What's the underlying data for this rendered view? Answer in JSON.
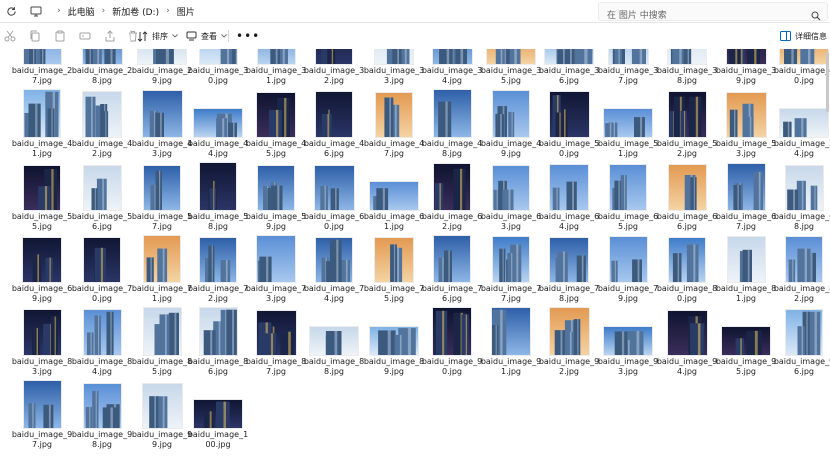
{
  "addressbar": {
    "breadcrumbs": [
      "此电脑",
      "新加卷 (D:)",
      "图片"
    ],
    "search_placeholder": "在 图片 中搜索"
  },
  "toolbar": {
    "sort_label": "排序",
    "view_label": "查看",
    "details_label": "详细信息",
    "icons": [
      "cut-icon",
      "copy-icon",
      "paste-icon",
      "rename-icon",
      "share-icon",
      "delete-icon"
    ]
  },
  "files": {
    "partial_top_row": [
      [
        "baidu_image_2",
        "7.jpg"
      ],
      [
        "baidu_image_2",
        "8.jpg"
      ],
      [
        "baidu_image_2",
        "9.jpg"
      ],
      [
        "baidu_image_3",
        "0.jpg"
      ],
      [
        "baidu_image_3",
        "1.jpg"
      ],
      [
        "baidu_image_3",
        "2.jpg"
      ],
      [
        "baidu_image_3",
        "3.jpg"
      ],
      [
        "baidu_image_3",
        "4.jpg"
      ],
      [
        "baidu_image_3",
        "5.jpg"
      ],
      [
        "baidu_image_3",
        "6.jpg"
      ],
      [
        "baidu_image_3",
        "7.jpg"
      ],
      [
        "baidu_image_3",
        "8.jpg"
      ],
      [
        "baidu_image_3",
        "9.jpg"
      ],
      [
        "baidu_image_4",
        "0.jpg"
      ]
    ],
    "rows": [
      [
        [
          "baidu_image_4",
          "1.jpg"
        ],
        [
          "baidu_image_4",
          "2.jpg"
        ],
        [
          "baidu_image_4",
          "3.jpg"
        ],
        [
          "baidu_image_4",
          "4.jpg"
        ],
        [
          "baidu_image_4",
          "5.jpg"
        ],
        [
          "baidu_image_4",
          "6.jpg"
        ],
        [
          "baidu_image_4",
          "7.jpg"
        ],
        [
          "baidu_image_4",
          "8.jpg"
        ],
        [
          "baidu_image_4",
          "9.jpg"
        ],
        [
          "baidu_image_5",
          "0.jpg"
        ],
        [
          "baidu_image_5",
          "1.jpg"
        ],
        [
          "baidu_image_5",
          "2.jpg"
        ],
        [
          "baidu_image_5",
          "3.jpg"
        ],
        [
          "baidu_image_5",
          "4.jpg"
        ]
      ],
      [
        [
          "baidu_image_5",
          "5.jpg"
        ],
        [
          "baidu_image_5",
          "6.jpg"
        ],
        [
          "baidu_image_5",
          "7.jpg"
        ],
        [
          "baidu_image_5",
          "8.jpg"
        ],
        [
          "baidu_image_5",
          "9.jpg"
        ],
        [
          "baidu_image_6",
          "0.jpg"
        ],
        [
          "baidu_image_6",
          "1.jpg"
        ],
        [
          "baidu_image_6",
          "2.jpg"
        ],
        [
          "baidu_image_6",
          "3.jpg"
        ],
        [
          "baidu_image_6",
          "4.jpg"
        ],
        [
          "baidu_image_6",
          "5.jpg"
        ],
        [
          "baidu_image_6",
          "6.jpg"
        ],
        [
          "baidu_image_6",
          "7.jpg"
        ],
        [
          "baidu_image_6",
          "8.jpg"
        ]
      ],
      [
        [
          "baidu_image_6",
          "9.jpg"
        ],
        [
          "baidu_image_7",
          "0.jpg"
        ],
        [
          "baidu_image_7",
          "1.jpg"
        ],
        [
          "baidu_image_7",
          "2.jpg"
        ],
        [
          "baidu_image_7",
          "3.jpg"
        ],
        [
          "baidu_image_7",
          "4.jpg"
        ],
        [
          "baidu_image_7",
          "5.jpg"
        ],
        [
          "baidu_image_7",
          "6.jpg"
        ],
        [
          "baidu_image_7",
          "7.jpg"
        ],
        [
          "baidu_image_7",
          "8.jpg"
        ],
        [
          "baidu_image_7",
          "9.jpg"
        ],
        [
          "baidu_image_8",
          "0.jpg"
        ],
        [
          "baidu_image_8",
          "1.jpg"
        ],
        [
          "baidu_image_8",
          "2.jpg"
        ]
      ],
      [
        [
          "baidu_image_8",
          "3.jpg"
        ],
        [
          "baidu_image_8",
          "4.jpg"
        ],
        [
          "baidu_image_8",
          "5.jpg"
        ],
        [
          "baidu_image_8",
          "6.jpg"
        ],
        [
          "baidu_image_8",
          "7.jpg"
        ],
        [
          "baidu_image_8",
          "8.jpg"
        ],
        [
          "baidu_image_8",
          "9.jpg"
        ],
        [
          "baidu_image_9",
          "0.jpg"
        ],
        [
          "baidu_image_9",
          "1.jpg"
        ],
        [
          "baidu_image_9",
          "2.jpg"
        ],
        [
          "baidu_image_9",
          "3.jpg"
        ],
        [
          "baidu_image_9",
          "4.jpg"
        ],
        [
          "baidu_image_9",
          "5.jpg"
        ],
        [
          "baidu_image_9",
          "6.jpg"
        ]
      ],
      [
        [
          "baidu_image_9",
          "7.jpg"
        ],
        [
          "baidu_image_9",
          "8.jpg"
        ],
        [
          "baidu_image_9",
          "9.jpg"
        ],
        [
          "baidu_image_1",
          "00.jpg"
        ]
      ]
    ]
  },
  "colors": {
    "sky_day": "#6f9fd8",
    "sky_night": "#141c3a",
    "sky_dusk": "#e89a4f",
    "glass": "#3c5a7e",
    "accent": "#0067c0"
  }
}
